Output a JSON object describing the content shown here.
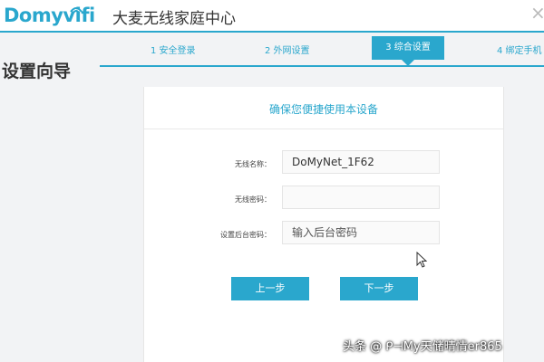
{
  "header": {
    "logo_text": "Domyvifi",
    "title": "大麦无线家庭中心",
    "close_glyph": "×"
  },
  "steps": [
    {
      "label": "1 安全登录"
    },
    {
      "label": "2 外网设置"
    },
    {
      "label": "3 综合设置"
    },
    {
      "label": "4 绑定手机"
    }
  ],
  "page_title": "设置向导",
  "card": {
    "title": "确保您便捷使用本设备",
    "fields": [
      {
        "label": "无线名称：",
        "value": "DoMyNet_1F62",
        "placeholder": ""
      },
      {
        "label": "无线密码：",
        "value": "",
        "placeholder": ""
      },
      {
        "label": "设置后台密码：",
        "value": "",
        "placeholder": "输入后台密码"
      }
    ],
    "prev_button": "上一步",
    "next_button": "下一步"
  },
  "watermark": "头条 @ ᑭ⊣My天储晴情er865",
  "colors": {
    "accent": "#2aa7cd",
    "background": "#f2f3f5"
  }
}
